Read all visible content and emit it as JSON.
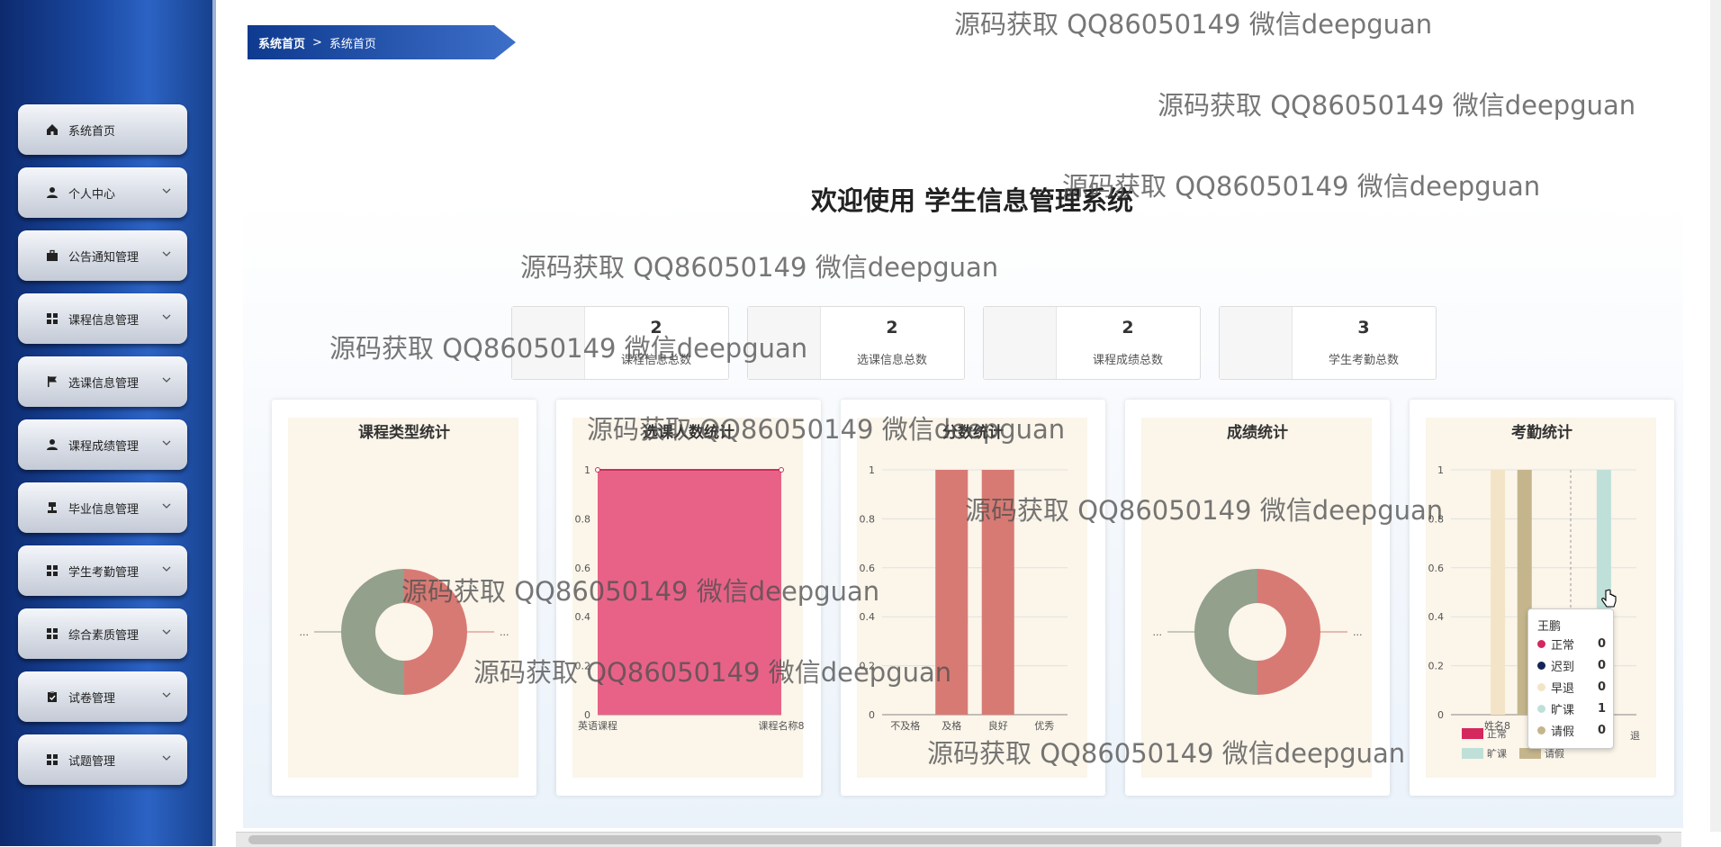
{
  "sidebar": {
    "items": [
      {
        "label": "系统首页",
        "icon": "home-icon",
        "expandable": false
      },
      {
        "label": "个人中心",
        "icon": "user-icon",
        "expandable": true
      },
      {
        "label": "公告通知管理",
        "icon": "briefcase-icon",
        "expandable": true
      },
      {
        "label": "课程信息管理",
        "icon": "grid-icon",
        "expandable": true
      },
      {
        "label": "选课信息管理",
        "icon": "flag-icon",
        "expandable": true
      },
      {
        "label": "课程成绩管理",
        "icon": "user-icon",
        "expandable": true
      },
      {
        "label": "毕业信息管理",
        "icon": "stamp-icon",
        "expandable": true
      },
      {
        "label": "学生考勤管理",
        "icon": "grid-icon",
        "expandable": true
      },
      {
        "label": "综合素质管理",
        "icon": "grid-icon",
        "expandable": true
      },
      {
        "label": "试卷管理",
        "icon": "clipboard-icon",
        "expandable": true
      },
      {
        "label": "试题管理",
        "icon": "grid-icon",
        "expandable": true
      }
    ]
  },
  "breadcrumb": {
    "home": "系统首页",
    "separator": ">",
    "current": "系统首页"
  },
  "welcome": "欢迎使用 学生信息管理系统",
  "stats": [
    {
      "value": "2",
      "label": "课程信息总数"
    },
    {
      "value": "2",
      "label": "选课信息总数"
    },
    {
      "value": "2",
      "label": "课程成绩总数"
    },
    {
      "value": "3",
      "label": "学生考勤总数"
    }
  ],
  "watermark": "源码获取 QQ86050149 微信deepguan",
  "colors": {
    "sidebar_dark": "#0d2a6e",
    "pie_red": "#d87a74",
    "pie_green": "#92a08c",
    "bar_pink": "#e86287",
    "bar_red": "#d87a74",
    "beige_light": "#f3e4c8",
    "beige_dark": "#c5b58c",
    "mint": "#bfe0d8"
  },
  "chart_data": [
    {
      "type": "pie",
      "title": "课程类型统计",
      "slices": [
        {
          "label": "...",
          "value": 1
        },
        {
          "label": "...",
          "value": 1
        }
      ],
      "donut": true
    },
    {
      "type": "area",
      "title": "选课人数统计",
      "categories": [
        "英语课程",
        "课程名称8"
      ],
      "values": [
        1,
        1
      ],
      "ylim": [
        0,
        1
      ],
      "yticks": [
        "0",
        "0.2",
        "0.4",
        "0.6",
        "0.8",
        "1"
      ]
    },
    {
      "type": "bar",
      "title": "分数统计",
      "categories": [
        "不及格",
        "及格",
        "良好",
        "优秀"
      ],
      "values": [
        0,
        1,
        1,
        0
      ],
      "ylim": [
        0,
        1
      ],
      "yticks": [
        "0",
        "0.2",
        "0.4",
        "0.6",
        "0.8",
        "1"
      ]
    },
    {
      "type": "pie",
      "title": "成绩统计",
      "slices": [
        {
          "label": "...",
          "value": 1
        },
        {
          "label": "...",
          "value": 1
        }
      ],
      "donut": true
    },
    {
      "type": "bar",
      "title": "考勤统计",
      "categories": [
        "姓名8",
        "王鹏"
      ],
      "series": [
        {
          "name": "正常",
          "values": [
            0,
            0
          ]
        },
        {
          "name": "迟到",
          "values": [
            0,
            0
          ]
        },
        {
          "name": "早退",
          "values": [
            1,
            0
          ]
        },
        {
          "name": "旷课",
          "values": [
            0,
            1
          ]
        },
        {
          "name": "请假",
          "values": [
            1,
            0
          ]
        }
      ],
      "ylim": [
        0,
        1
      ],
      "yticks": [
        "0",
        "0.2",
        "0.4",
        "0.6",
        "0.8",
        "1"
      ],
      "legend_visible": [
        "正常",
        "旷课",
        "请假",
        "退"
      ],
      "tooltip": {
        "title": "王鹏",
        "rows": [
          {
            "name": "正常",
            "value": "0",
            "color": "#d4285e"
          },
          {
            "name": "迟到",
            "value": "0",
            "color": "#142456"
          },
          {
            "name": "早退",
            "value": "0",
            "color": "#f3e4c8"
          },
          {
            "name": "旷课",
            "value": "1",
            "color": "#bfe0d8"
          },
          {
            "name": "请假",
            "value": "0",
            "color": "#c5b58c"
          }
        ]
      }
    }
  ]
}
